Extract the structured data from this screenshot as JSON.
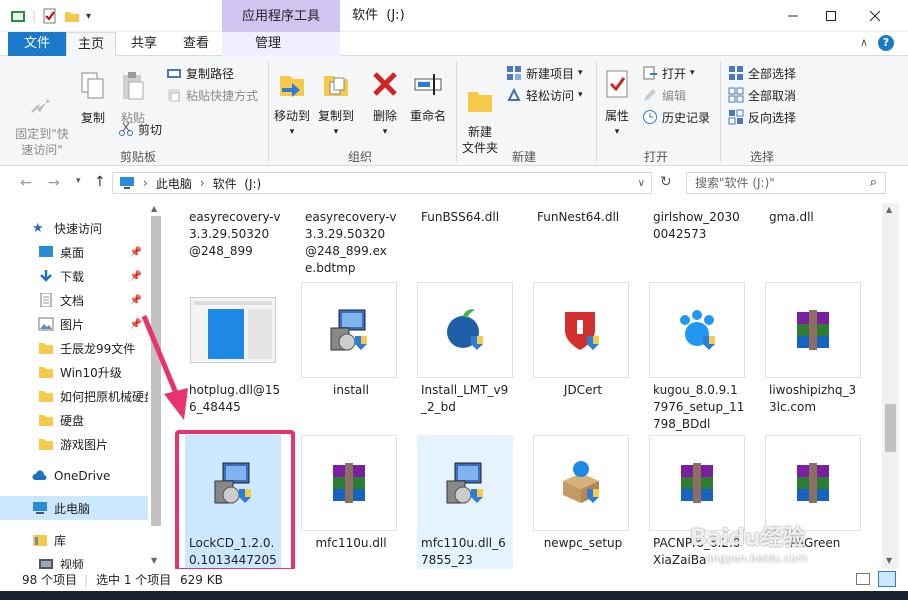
{
  "window": {
    "context_tab": "应用程序工具",
    "title": "软件",
    "title_drive": "(J:)"
  },
  "ribbon_tabs": {
    "file": "文件",
    "home": "主页",
    "share": "共享",
    "view": "查看",
    "manage": "管理"
  },
  "ribbon": {
    "pin_quick": "固定到\"快\n速访问\"",
    "copy": "复制",
    "paste": "粘贴",
    "copy_path": "复制路径",
    "paste_shortcut": "粘贴快捷方式",
    "cut": "剪切",
    "clipboard_group": "剪贴板",
    "move_to": "移动到",
    "copy_to": "复制到",
    "delete": "删除",
    "rename": "重命名",
    "organize_group": "组织",
    "new_folder": "新建\n文件夹",
    "new_item": "新建项目",
    "easy_access": "轻松访问",
    "new_group": "新建",
    "properties": "属性",
    "open": "打开",
    "edit": "编辑",
    "history": "历史记录",
    "open_group": "打开",
    "select_all": "全部选择",
    "select_none": "全部取消",
    "invert_select": "反向选择",
    "select_group": "选择"
  },
  "address": {
    "crumb1": "此电脑",
    "crumb2": "软件",
    "crumb2_drive": "(J:)",
    "search_placeholder": "搜索\"软件 (J:)\""
  },
  "sidebar": {
    "items": [
      {
        "label": "快速访问"
      },
      {
        "label": "桌面"
      },
      {
        "label": "下载"
      },
      {
        "label": "文档"
      },
      {
        "label": "图片"
      },
      {
        "label": "壬辰龙99文件"
      },
      {
        "label": "Win10升级"
      },
      {
        "label": "如何把原机械硬盘"
      },
      {
        "label": "硬盘"
      },
      {
        "label": "游戏图片"
      },
      {
        "label": "OneDrive"
      },
      {
        "label": "此电脑"
      },
      {
        "label": "库"
      },
      {
        "label": "视频"
      }
    ]
  },
  "files": {
    "row1": [
      "easyrecovery-v3.3.29.50320@248_899",
      "easyrecovery-v3.3.29.50320@248_899.exe.bdtmp",
      "FunBSS64.dll",
      "FunNest64.dll",
      "girlshow_20300042573",
      "gma.dll"
    ],
    "row2": [
      "hotplug.dll@156_48445",
      "install",
      "Install_LMT_v9_2_bd",
      "JDCert",
      "kugou_8.0.9.17976_setup_11798_BDdl",
      "liwoshipizhq_33lc.com"
    ],
    "row3": [
      "LockCD_1.2.0.0.1013447205",
      "mfc110u.dll",
      "mfc110u.dll_67855_23",
      "newpc_setup",
      "PACNPro_6.2.0XiaZaiBa",
      "PAGreen"
    ]
  },
  "status": {
    "count": "98 个项目",
    "selected": "选中 1 个项目",
    "size": "629 KB"
  },
  "watermark": {
    "brand": "Baidu经验",
    "url": "jingyan.baidu.com"
  },
  "colors": {
    "accent": "#1979ca",
    "highlight": "#e8336d",
    "selected": "#cce8ff"
  }
}
